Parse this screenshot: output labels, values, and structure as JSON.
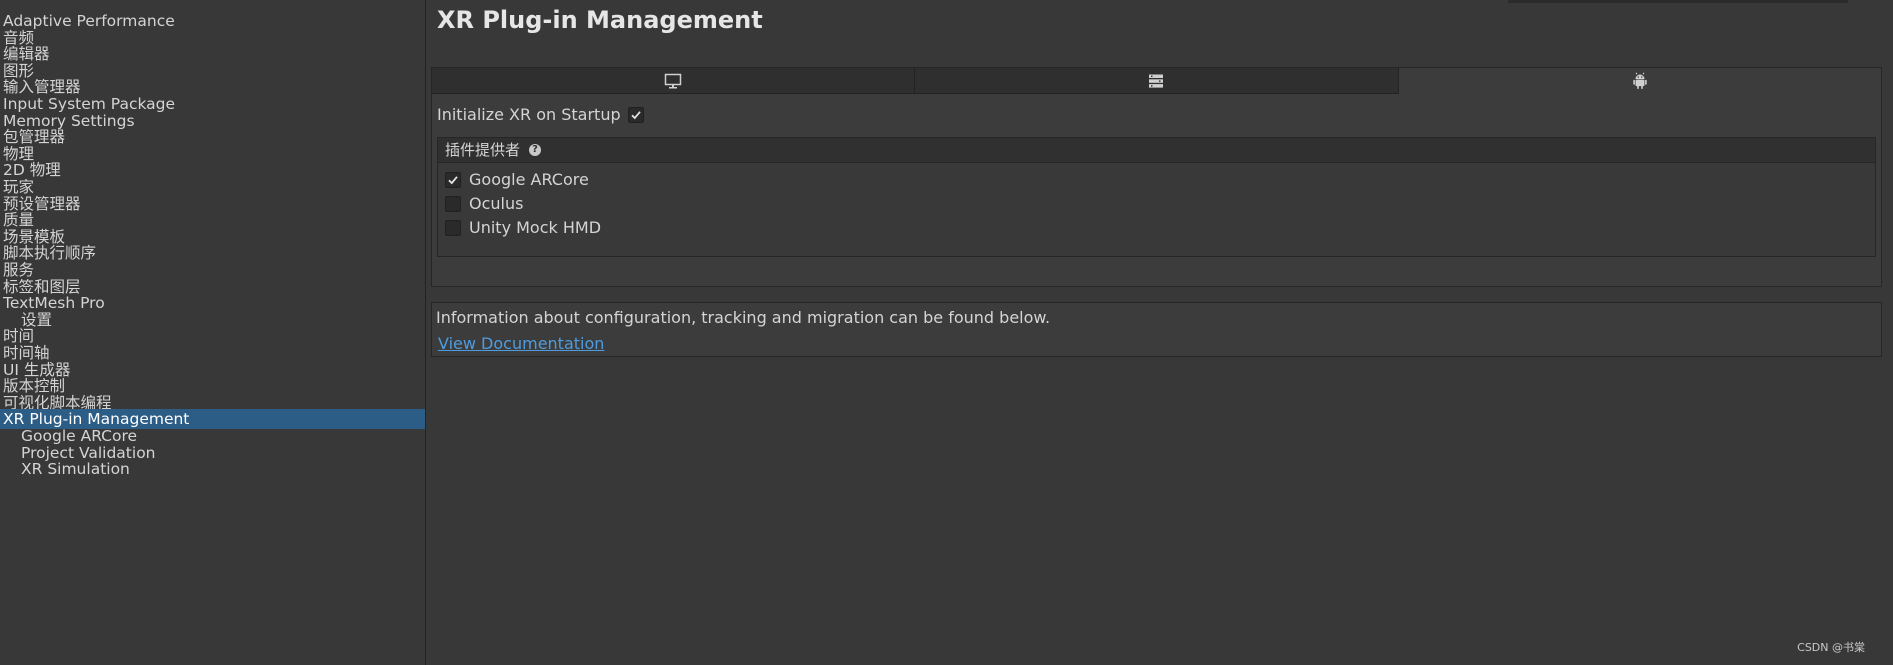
{
  "sidebar": {
    "items": [
      {
        "label": "Adaptive Performance",
        "child": false,
        "selected": false
      },
      {
        "label": "音频",
        "child": false,
        "selected": false
      },
      {
        "label": "编辑器",
        "child": false,
        "selected": false
      },
      {
        "label": "图形",
        "child": false,
        "selected": false
      },
      {
        "label": "输入管理器",
        "child": false,
        "selected": false
      },
      {
        "label": "Input System Package",
        "child": false,
        "selected": false
      },
      {
        "label": "Memory Settings",
        "child": false,
        "selected": false
      },
      {
        "label": "包管理器",
        "child": false,
        "selected": false
      },
      {
        "label": "物理",
        "child": false,
        "selected": false
      },
      {
        "label": "2D 物理",
        "child": false,
        "selected": false
      },
      {
        "label": "玩家",
        "child": false,
        "selected": false
      },
      {
        "label": "预设管理器",
        "child": false,
        "selected": false
      },
      {
        "label": "质量",
        "child": false,
        "selected": false
      },
      {
        "label": "场景模板",
        "child": false,
        "selected": false
      },
      {
        "label": "脚本执行顺序",
        "child": false,
        "selected": false
      },
      {
        "label": "服务",
        "child": false,
        "selected": false
      },
      {
        "label": "标签和图层",
        "child": false,
        "selected": false
      },
      {
        "label": "TextMesh Pro",
        "child": false,
        "selected": false
      },
      {
        "label": "设置",
        "child": true,
        "selected": false
      },
      {
        "label": "时间",
        "child": false,
        "selected": false
      },
      {
        "label": "时间轴",
        "child": false,
        "selected": false
      },
      {
        "label": "UI 生成器",
        "child": false,
        "selected": false
      },
      {
        "label": "版本控制",
        "child": false,
        "selected": false
      },
      {
        "label": "可视化脚本编程",
        "child": false,
        "selected": false
      },
      {
        "label": "XR Plug-in Management",
        "child": false,
        "selected": true
      },
      {
        "label": "Google ARCore",
        "child": true,
        "selected": false
      },
      {
        "label": "Project Validation",
        "child": true,
        "selected": false
      },
      {
        "label": "XR Simulation",
        "child": true,
        "selected": false
      }
    ]
  },
  "main": {
    "title": "XR Plug-in Management",
    "tabs": [
      {
        "icon": "monitor-icon",
        "active": false
      },
      {
        "icon": "server-icon",
        "active": false
      },
      {
        "icon": "android-icon",
        "active": true
      }
    ],
    "init_label": "Initialize XR on Startup",
    "init_checked": true,
    "providers_title": "插件提供者",
    "providers": [
      {
        "label": "Google ARCore",
        "checked": true
      },
      {
        "label": "Oculus",
        "checked": false
      },
      {
        "label": "Unity Mock HMD",
        "checked": false
      }
    ],
    "info_text": "Information about configuration, tracking and migration can be found below.",
    "doc_link": "View Documentation"
  },
  "watermark": "CSDN @书棠",
  "colors": {
    "background": "#383838",
    "selection": "#2c5d87",
    "link": "#4e9ce0"
  }
}
